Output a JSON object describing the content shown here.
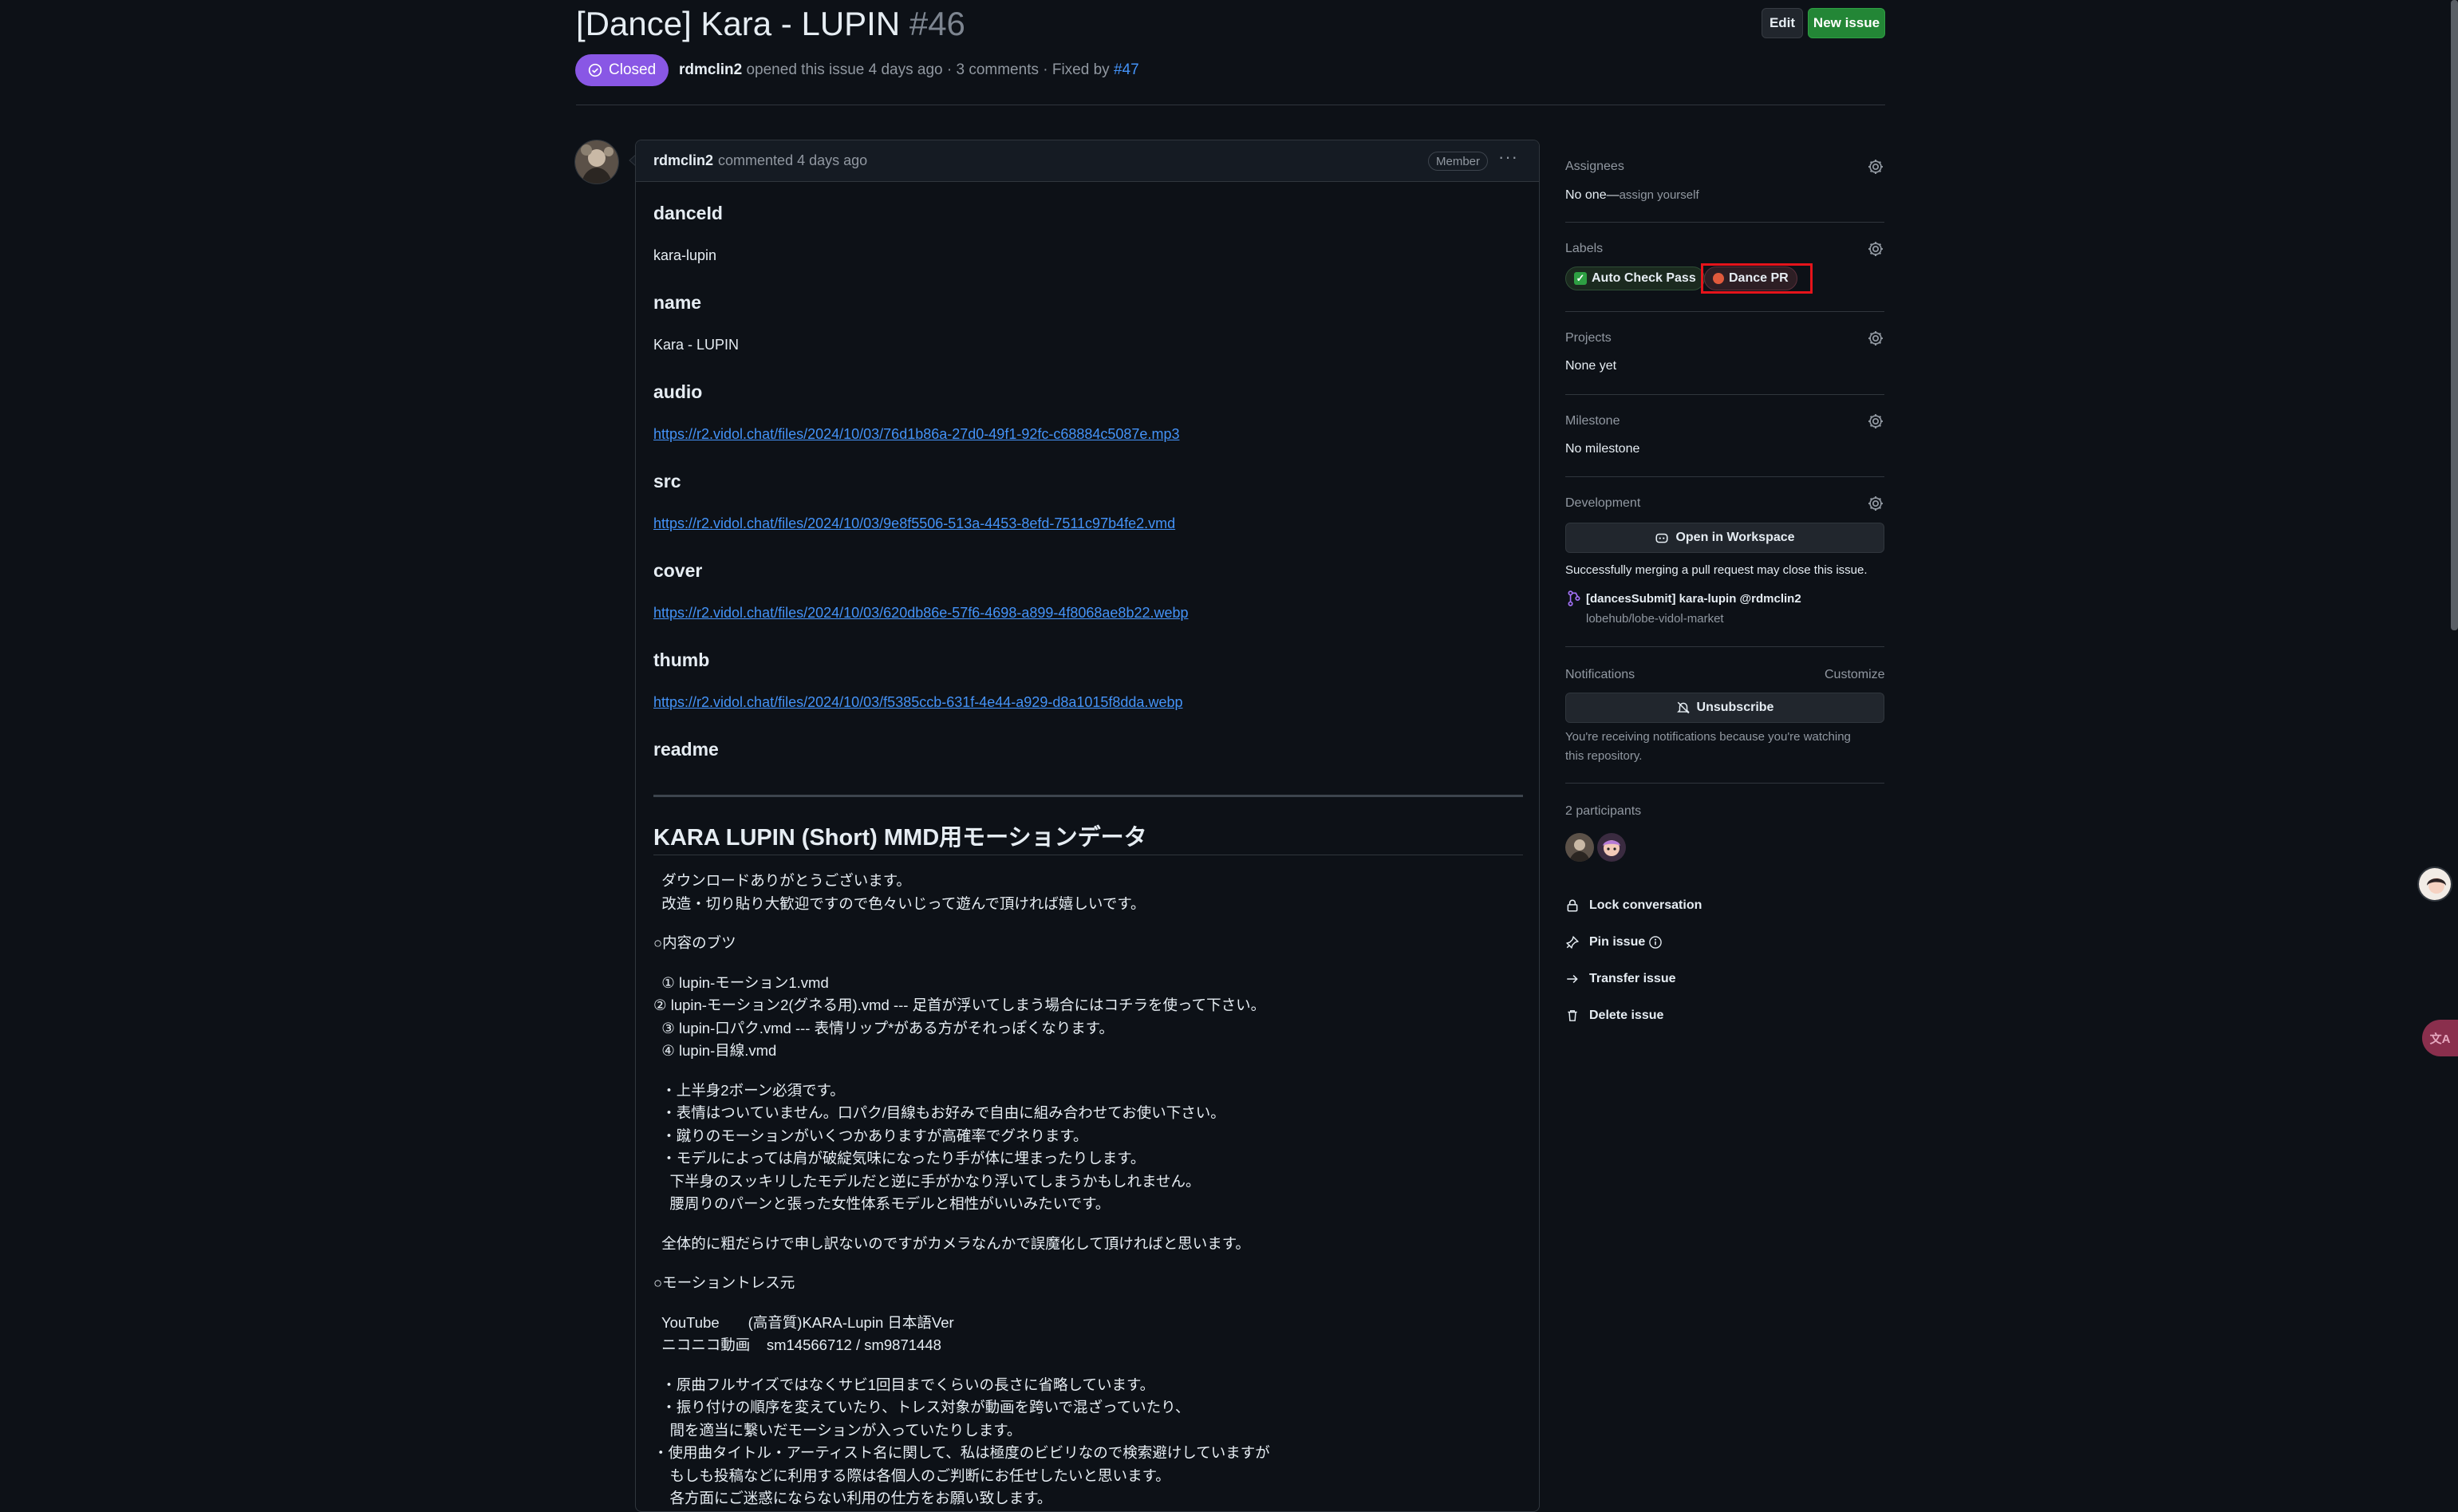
{
  "issue": {
    "title": "[Dance] Kara - LUPIN",
    "number": "#46",
    "edit_label": "Edit",
    "new_issue_label": "New issue",
    "state": "Closed",
    "author": "rdmclin2",
    "meta_text": "opened this issue 4 days ago · 3 comments · Fixed by",
    "fixed_by": "#47"
  },
  "comment": {
    "author": "rdmclin2",
    "action": "commented 4 days ago",
    "role": "Member",
    "menu": "···",
    "fields": [
      {
        "heading": "danceId",
        "value": "kara-lupin",
        "is_link": false
      },
      {
        "heading": "name",
        "value": "Kara - LUPIN",
        "is_link": false
      },
      {
        "heading": "audio",
        "value": "https://r2.vidol.chat/files/2024/10/03/76d1b86a-27d0-49f1-92fc-c68884c5087e.mp3",
        "is_link": true
      },
      {
        "heading": "src",
        "value": "https://r2.vidol.chat/files/2024/10/03/9e8f5506-513a-4453-8efd-7511c97b4fe2.vmd",
        "is_link": true
      },
      {
        "heading": "cover",
        "value": "https://r2.vidol.chat/files/2024/10/03/620db86e-57f6-4698-a899-4f8068ae8b22.webp",
        "is_link": true
      },
      {
        "heading": "thumb",
        "value": "https://r2.vidol.chat/files/2024/10/03/f5385ccb-631f-4e44-a929-d8a1015f8dda.webp",
        "is_link": true
      }
    ],
    "readme_heading": "readme",
    "readme_title": "KARA LUPIN (Short) MMD用モーションデータ",
    "readme_lines": [
      "  ダウンロードありがとうございます。",
      "  改造・切り貼り大歓迎ですので色々いじって遊んで頂ければ嬉しいです。",
      "",
      "○内容のブツ",
      "",
      "  ① lupin-モーション1.vmd",
      "② lupin-モーション2(グネる用).vmd --- 足首が浮いてしまう場合にはコチラを使って下さい。",
      "  ③ lupin-口パク.vmd --- 表情リップ*がある方がそれっぽくなります。",
      "  ④ lupin-目線.vmd",
      "",
      "  ・上半身2ボーン必須です。",
      "  ・表情はついていません。口パク/目線もお好みで自由に組み合わせてお使い下さい。",
      "  ・蹴りのモーションがいくつかありますが高確率でグネります。",
      "  ・モデルによっては肩が破綻気味になったり手が体に埋まったりします。",
      "    下半身のスッキリしたモデルだと逆に手がかなり浮いてしまうかもしれません。",
      "    腰周りのパーンと張った女性体系モデルと相性がいいみたいです。",
      "",
      "  全体的に粗だらけで申し訳ないのですがカメラなんかで誤魔化して頂ければと思います。",
      "",
      "○モーショントレス元",
      "",
      "  YouTube       (高音質)KARA-Lupin 日本語Ver",
      "  ニコニコ動画    sm14566712 / sm9871448",
      "",
      "  ・原曲フルサイズではなくサビ1回目までくらいの長さに省略しています。",
      "  ・振り付けの順序を変えていたり、トレス対象が動画を跨いで混ざっていたり、",
      "    間を適当に繋いだモーションが入っていたりします。",
      "・使用曲タイトル・アーティスト名に関して、私は極度のビビリなので検索避けしていますが",
      "    もしも投稿などに利用する際は各個人のご判断にお任せしたいと思います。",
      "    各方面にご迷惑にならない利用の仕方をお願い致します。"
    ]
  },
  "sidebar": {
    "assignees_heading": "Assignees",
    "assignees_value": "No one—",
    "assign_yourself": "assign yourself",
    "labels_heading": "Labels",
    "labels": [
      {
        "text": "Auto Check Pass",
        "color": "#238636"
      },
      {
        "text": "Dance PR",
        "color": "#da3633"
      }
    ],
    "projects_heading": "Projects",
    "projects_value": "None yet",
    "milestone_heading": "Milestone",
    "milestone_value": "No milestone",
    "development_heading": "Development",
    "open_workspace": "Open in Workspace",
    "dev_note": "Successfully merging a pull request may close this issue.",
    "pr_title": "[dancesSubmit] kara-lupin @rdmclin2",
    "pr_repo": "lobehub/lobe-vidol-market",
    "notifications_heading": "Notifications",
    "customize": "Customize",
    "unsubscribe": "Unsubscribe",
    "notif_note_1": "You're receiving notifications because you're watching",
    "notif_note_2": "this repository.",
    "participants_heading": "2 participants",
    "actions": [
      {
        "icon": "lock-icon",
        "text": "Lock conversation"
      },
      {
        "icon": "pin-icon",
        "text": "Pin issue"
      },
      {
        "icon": "arrow-right-icon",
        "text": "Transfer issue"
      },
      {
        "icon": "trash-icon",
        "text": "Delete issue"
      }
    ]
  },
  "colors": {
    "background": "#0d1117",
    "closed_purple": "#8957e5",
    "new_issue_green": "#238636",
    "link_blue": "#4493f8",
    "highlight_red": "#e5141b"
  }
}
